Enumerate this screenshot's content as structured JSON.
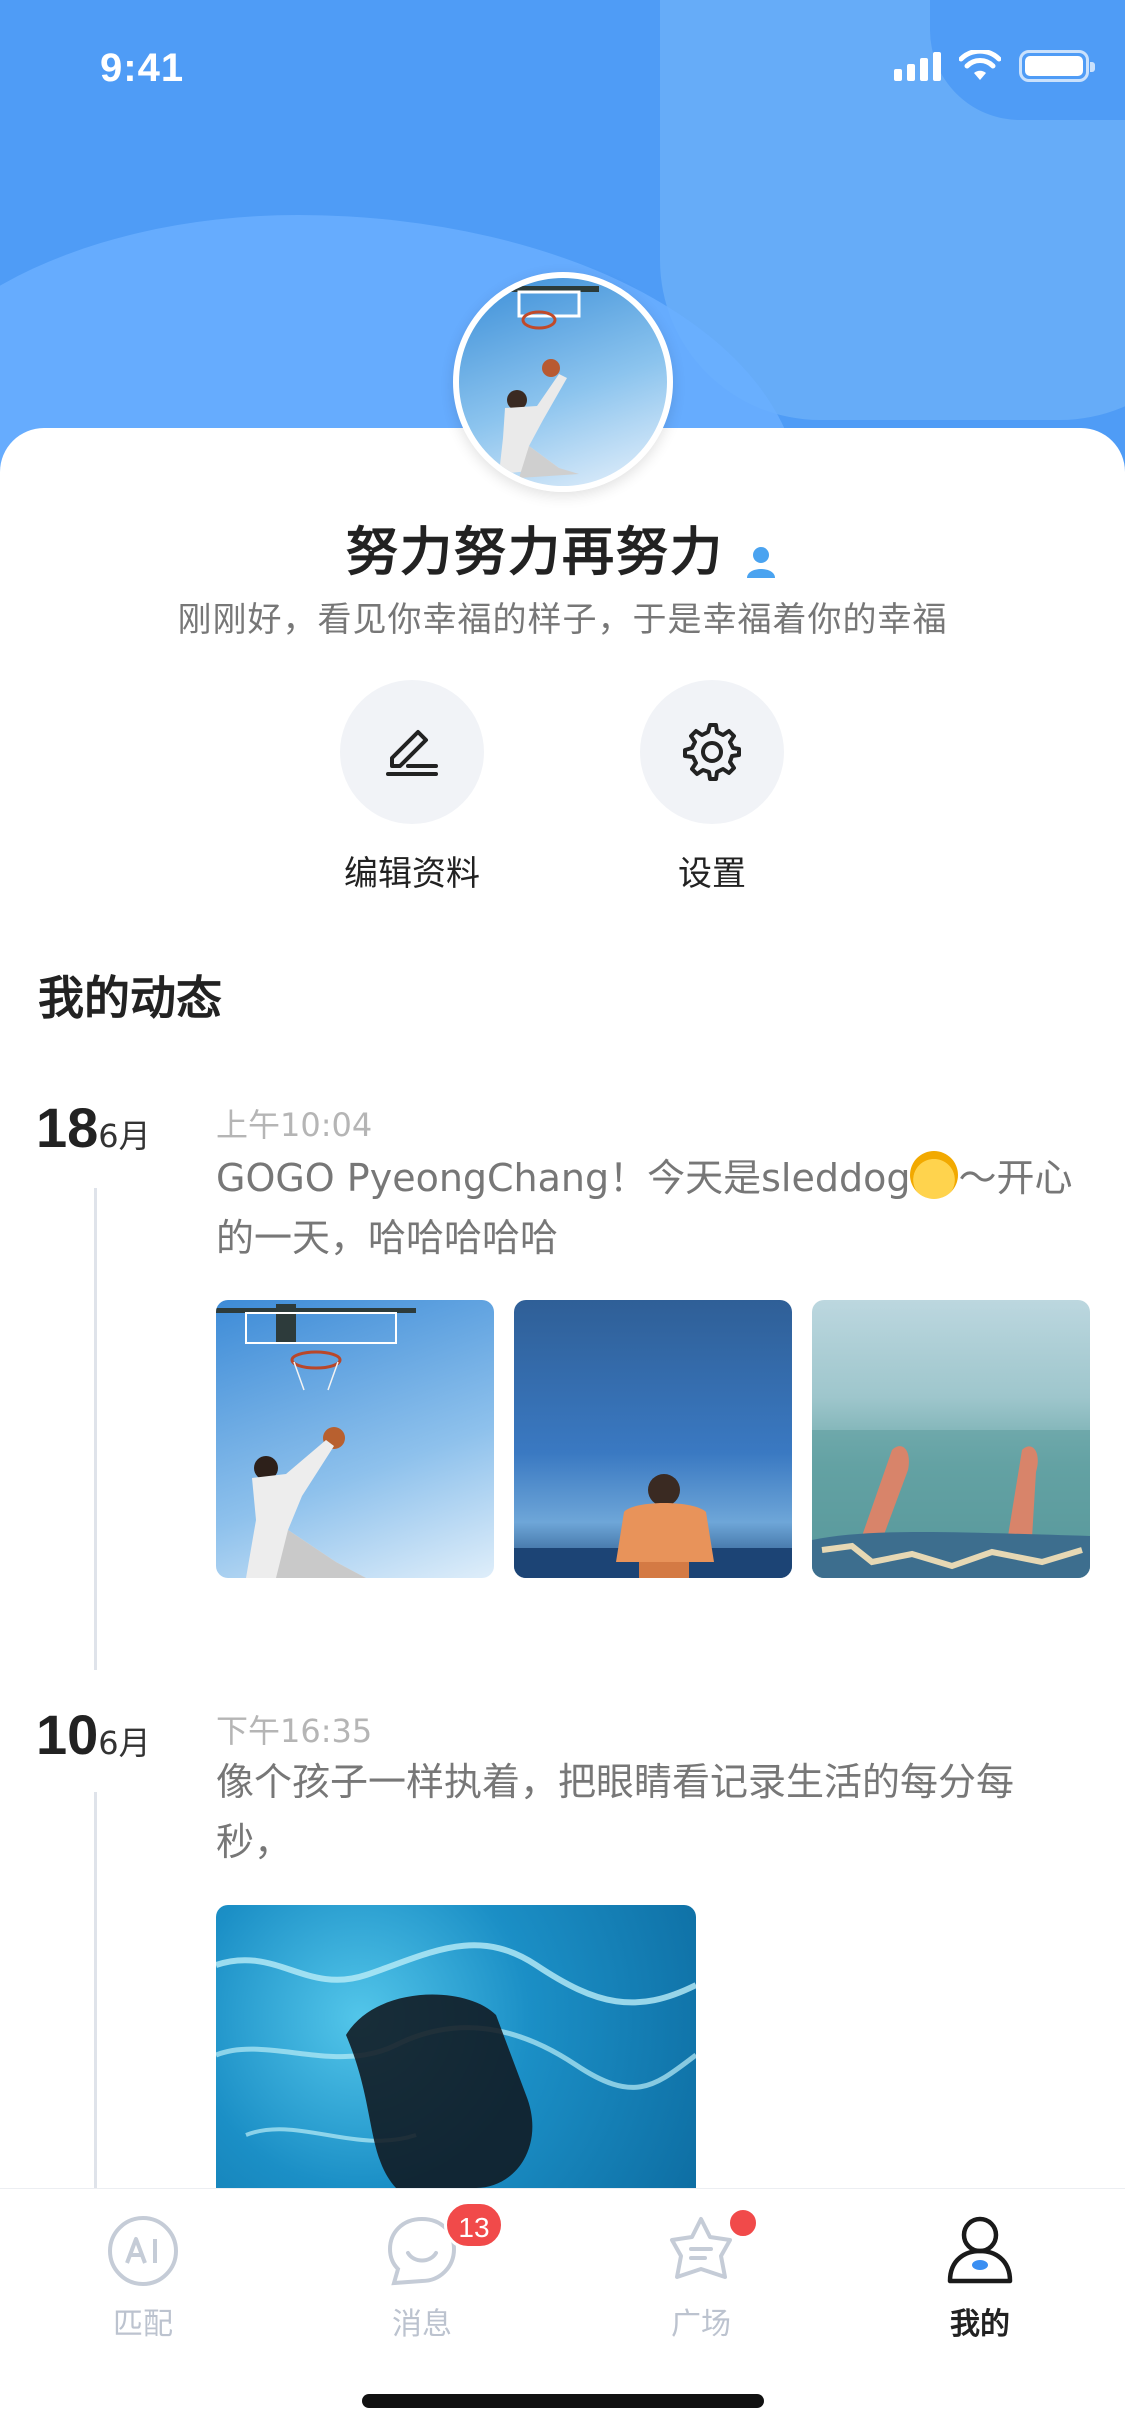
{
  "status_bar": {
    "time": "9:41"
  },
  "profile": {
    "name": "努力努力再努力",
    "bio": "刚刚好，看见你幸福的样子，于是幸福着你的幸福"
  },
  "actions": {
    "edit_label": "编辑资料",
    "settings_label": "设置"
  },
  "section": {
    "title": "我的动态"
  },
  "posts": [
    {
      "day": "18",
      "month": "6月",
      "time": "上午10:04",
      "text_before_emoji": "GOGO PyeongChang！今天是sleddog",
      "text_after_emoji": "～开心的一天，哈哈哈哈哈",
      "emoji_icon": "girl-emoji",
      "photos": [
        "basketball-photo",
        "beach-man-photo",
        "feet-in-water-photo"
      ]
    },
    {
      "day": "10",
      "month": "6月",
      "time": "下午16:35",
      "text": "像个孩子一样执着，把眼睛看记录生活的每分每秒，",
      "photos": [
        "underwater-hand-photo"
      ]
    }
  ],
  "tabbar": {
    "items": [
      {
        "label": "匹配",
        "icon": "ai-icon",
        "active": false
      },
      {
        "label": "消息",
        "icon": "chat-bubble-icon",
        "badge": "13",
        "active": false
      },
      {
        "label": "广场",
        "icon": "star-bubble-icon",
        "dot": true,
        "active": false
      },
      {
        "label": "我的",
        "icon": "person-icon",
        "active": true
      }
    ]
  },
  "colors": {
    "header_blue": "#4f9cf6",
    "badge_red": "#f14a4a",
    "user_badge_blue": "#4aa3f0"
  }
}
